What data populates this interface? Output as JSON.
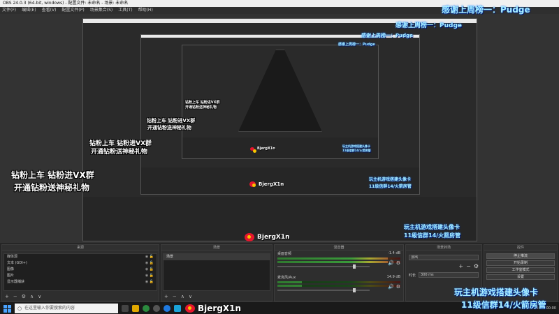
{
  "window": {
    "title": "OBS 24.0.3 (64-bit, windows) - 配置文件: 未命名 - 场景: 未命名"
  },
  "menu": [
    "文件(F)",
    "编辑(E)",
    "查看(V)",
    "配置文件(P)",
    "场景集合(S)",
    "工具(T)",
    "帮助(H)"
  ],
  "overlays": {
    "thanks_top": "感谢上周榜一：Pudge",
    "promo_line1": "钻粉上车 钻粉进VX群",
    "promo_line2": "开通钻粉送神秘礼物",
    "ad_line1": "玩主机游戏搭建头像卡",
    "ad_line2": "11级信群14/火箭房管",
    "weibo_name": "BjergX1n"
  },
  "docks": {
    "sources": {
      "title": "来源",
      "items": [
        "媒体源",
        "文本 (GDI+)",
        "图像",
        "图片",
        "显示器捕获"
      ]
    },
    "scenes": {
      "title": "场景",
      "items": [
        "场景"
      ]
    },
    "mixer": {
      "title": "混音器",
      "channels": [
        {
          "name": "桌面音频",
          "db": "-1.4 dB",
          "level": 0.9,
          "volume": 0.82
        },
        {
          "name": "麦克风/Aux",
          "db": "14.9 dB",
          "level": 0.2,
          "volume": 0.82
        }
      ]
    },
    "transitions": {
      "title": "场景转场",
      "selected": "淡出",
      "duration_label": "时长",
      "duration_value": "300 ms"
    },
    "controls": {
      "title": "控件",
      "buttons": [
        "停止推流",
        "开始录制",
        "工作室模式",
        "设置"
      ]
    }
  },
  "status": {
    "cpu": "CPU: 00:00:00"
  },
  "taskbar": {
    "search_placeholder": "在这里输入你要搜索的内容"
  }
}
